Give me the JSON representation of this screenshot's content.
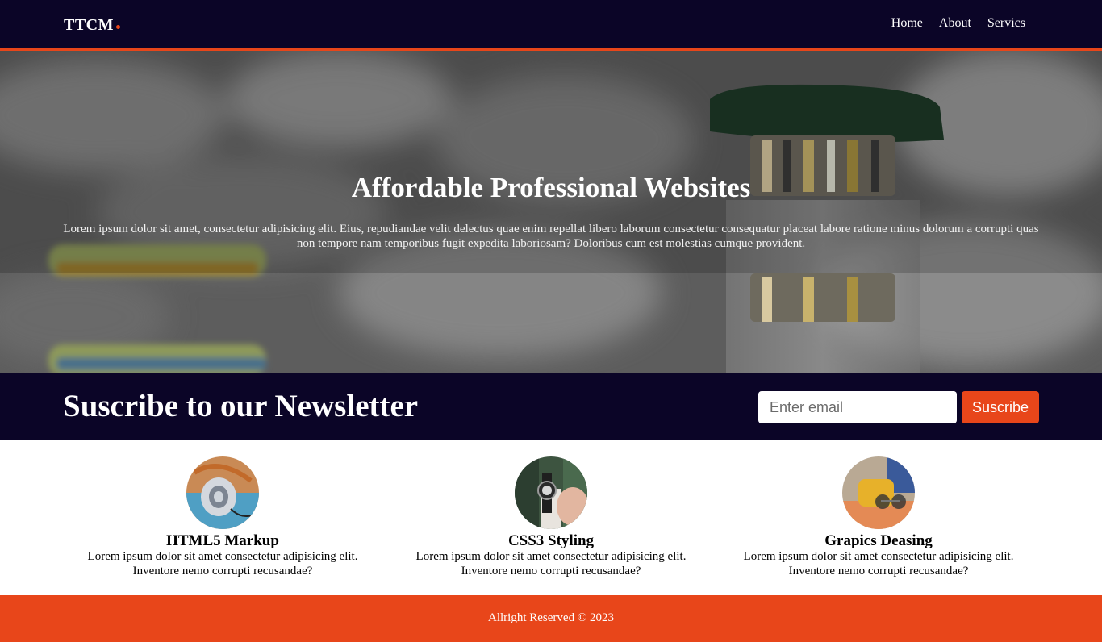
{
  "header": {
    "logo": "TTCM",
    "nav": [
      {
        "label": "Home"
      },
      {
        "label": "About"
      },
      {
        "label": "Servics"
      }
    ]
  },
  "hero": {
    "title": "Affordable Professional Websites",
    "text": "Lorem ipsum dolor sit amet, consectetur adipisicing elit. Eius, repudiandae velit delectus quae enim repellat libero laborum consectetur consequatur placeat labore ratione minus dolorum a corrupti quas non tempore nam temporibus fugit expedita laboriosam? Doloribus cum est molestias cumque provident."
  },
  "newsletter": {
    "title": "Suscribe to our Newsletter",
    "email_placeholder": "Enter email",
    "button_label": "Suscribe"
  },
  "features": [
    {
      "title": "HTML5 Markup",
      "text": "Lorem ipsum dolor sit amet consectetur adipisicing elit. Inventore nemo corrupti recusandae?",
      "image": "headphones"
    },
    {
      "title": "CSS3 Styling",
      "text": "Lorem ipsum dolor sit amet consectetur adipisicing elit. Inventore nemo corrupti recusandae?",
      "image": "wristwatch"
    },
    {
      "title": "Grapics Deasing",
      "text": "Lorem ipsum dolor sit amet consectetur adipisicing elit. Inventore nemo corrupti recusandae?",
      "image": "sunglasses"
    }
  ],
  "footer": {
    "text": "Allright Reserved © 2023"
  },
  "colors": {
    "navy": "#0b0527",
    "accent": "#e8461a"
  }
}
